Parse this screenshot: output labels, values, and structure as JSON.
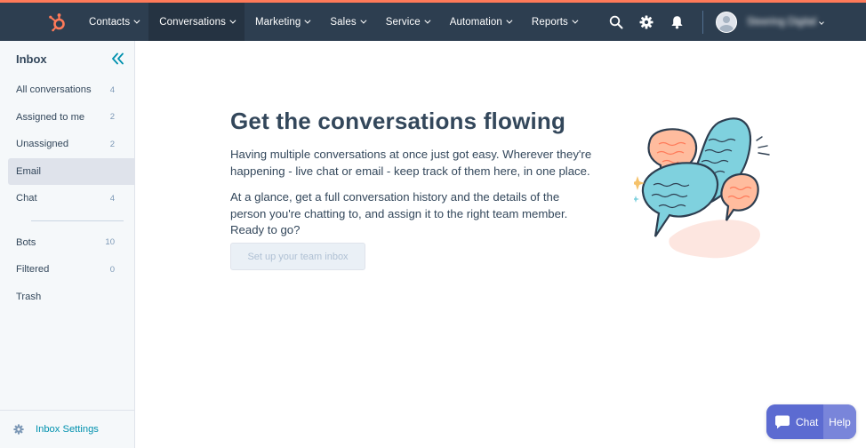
{
  "colors": {
    "nav_bg": "#2d3e50",
    "nav_active_bg": "#253342",
    "accent_top": "#ff7a59",
    "brand_orange": "#ff7a59",
    "sidebar_bg": "#f5f8fa",
    "link_teal": "#0091ae",
    "widget_purple": "#6a78d1"
  },
  "topnav": {
    "logo_icon": "hubspot-sprocket-icon",
    "items": [
      {
        "label": "Contacts",
        "active": false
      },
      {
        "label": "Conversations",
        "active": true
      },
      {
        "label": "Marketing",
        "active": false
      },
      {
        "label": "Sales",
        "active": false
      },
      {
        "label": "Service",
        "active": false
      },
      {
        "label": "Automation",
        "active": false
      },
      {
        "label": "Reports",
        "active": false
      }
    ],
    "right_icons": [
      "search-icon",
      "gear-icon",
      "bell-icon"
    ],
    "account_name": "Steering Digital"
  },
  "sidebar": {
    "title": "Inbox",
    "collapse_icon": "double-chevron-left-icon",
    "items": [
      {
        "label": "All conversations",
        "count": "4",
        "active": false
      },
      {
        "label": "Assigned to me",
        "count": "2",
        "active": false
      },
      {
        "label": "Unassigned",
        "count": "2",
        "active": false
      },
      {
        "label": "Email",
        "count": "",
        "active": true
      },
      {
        "label": "Chat",
        "count": "4",
        "active": false
      }
    ],
    "items_secondary": [
      {
        "label": "Bots",
        "count": "10"
      },
      {
        "label": "Filtered",
        "count": "0"
      },
      {
        "label": "Trash",
        "count": ""
      }
    ],
    "footer": {
      "label": "Inbox Settings",
      "icon": "gear-icon"
    }
  },
  "main": {
    "headline": "Get the conversations flowing",
    "paragraph_1": "Having multiple conversations at once just got easy. Wherever they're happening - live chat or email - keep track of them here, in one place.",
    "paragraph_2": "At a glance, get a full conversation history and the details of the person you're chatting to, and assign it to the right team member. Ready to go?",
    "cta_label": "Set up your team inbox",
    "illustration": "chat-bubbles-illustration"
  },
  "chat_widget": {
    "chat_label": "Chat",
    "help_label": "Help",
    "icon": "chat-bubble-icon"
  }
}
